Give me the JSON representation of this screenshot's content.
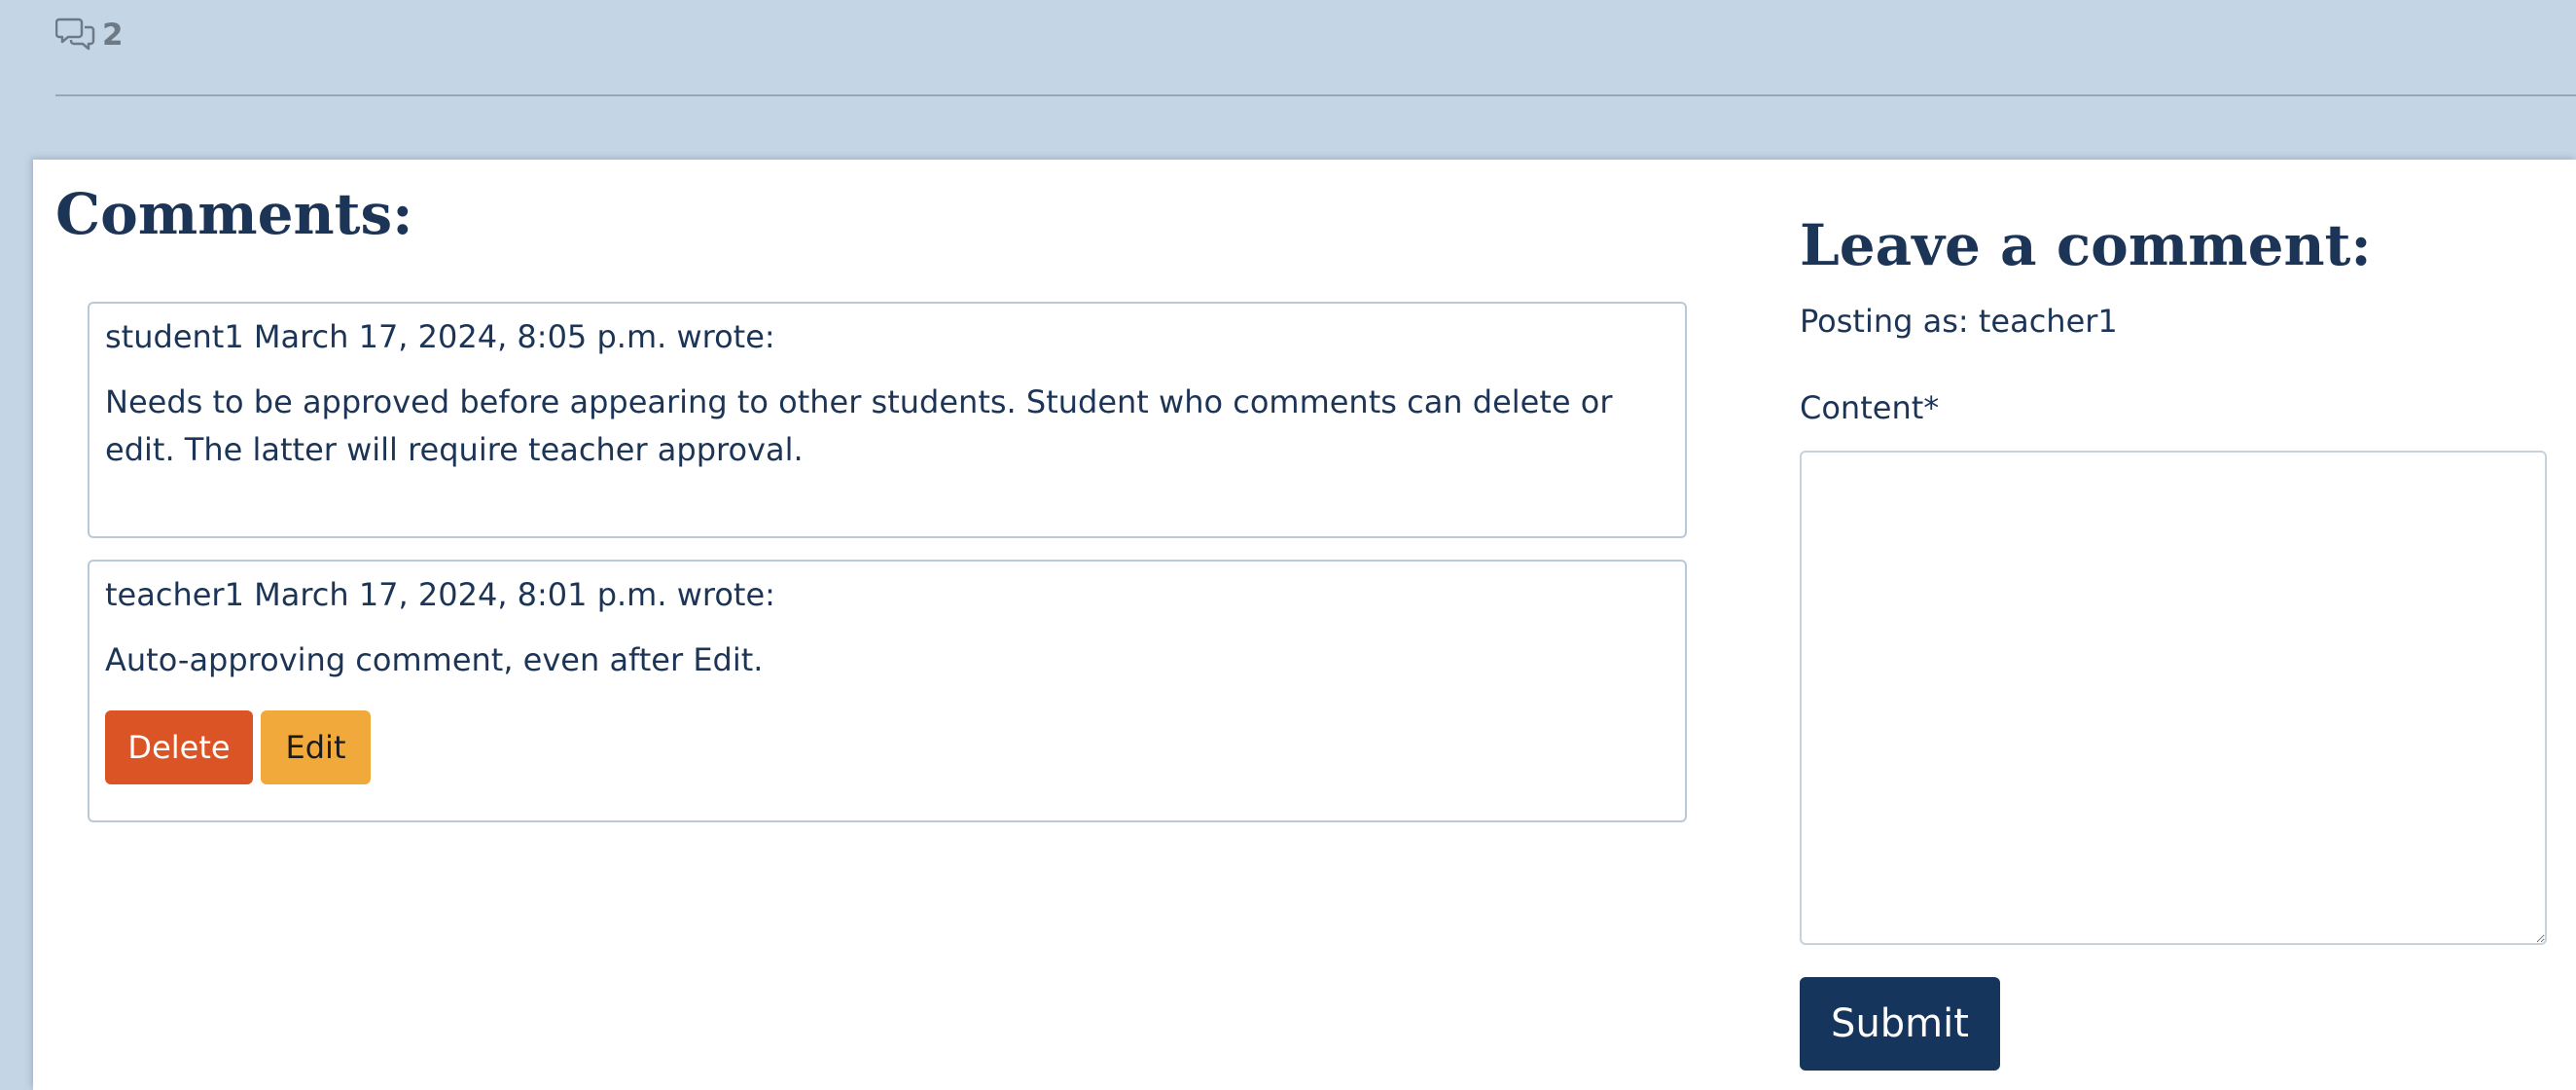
{
  "header": {
    "comment_count": "2",
    "comment_icon": "comments-icon"
  },
  "comments_section": {
    "title": "Comments:",
    "comments": [
      {
        "meta": "student1 March 17, 2024, 8:05 p.m. wrote:",
        "body": "Needs to be approved before appearing to other students. Student who comments can delete or edit. The latter will require teacher approval."
      },
      {
        "meta": "teacher1 March 17, 2024, 8:01 p.m. wrote:",
        "body": "Auto-approving comment, even after Edit.",
        "delete_label": "Delete",
        "edit_label": "Edit"
      }
    ]
  },
  "comment_form": {
    "title": "Leave a comment:",
    "posting_as": "Posting as: teacher1",
    "content_label": "Content*",
    "content_value": "",
    "submit_label": "Submit"
  },
  "colors": {
    "page_background": "#c4d5e6",
    "primary_text": "#1c3556",
    "delete_button": "#db5426",
    "edit_button": "#f2a93b",
    "submit_button": "#16355c"
  }
}
